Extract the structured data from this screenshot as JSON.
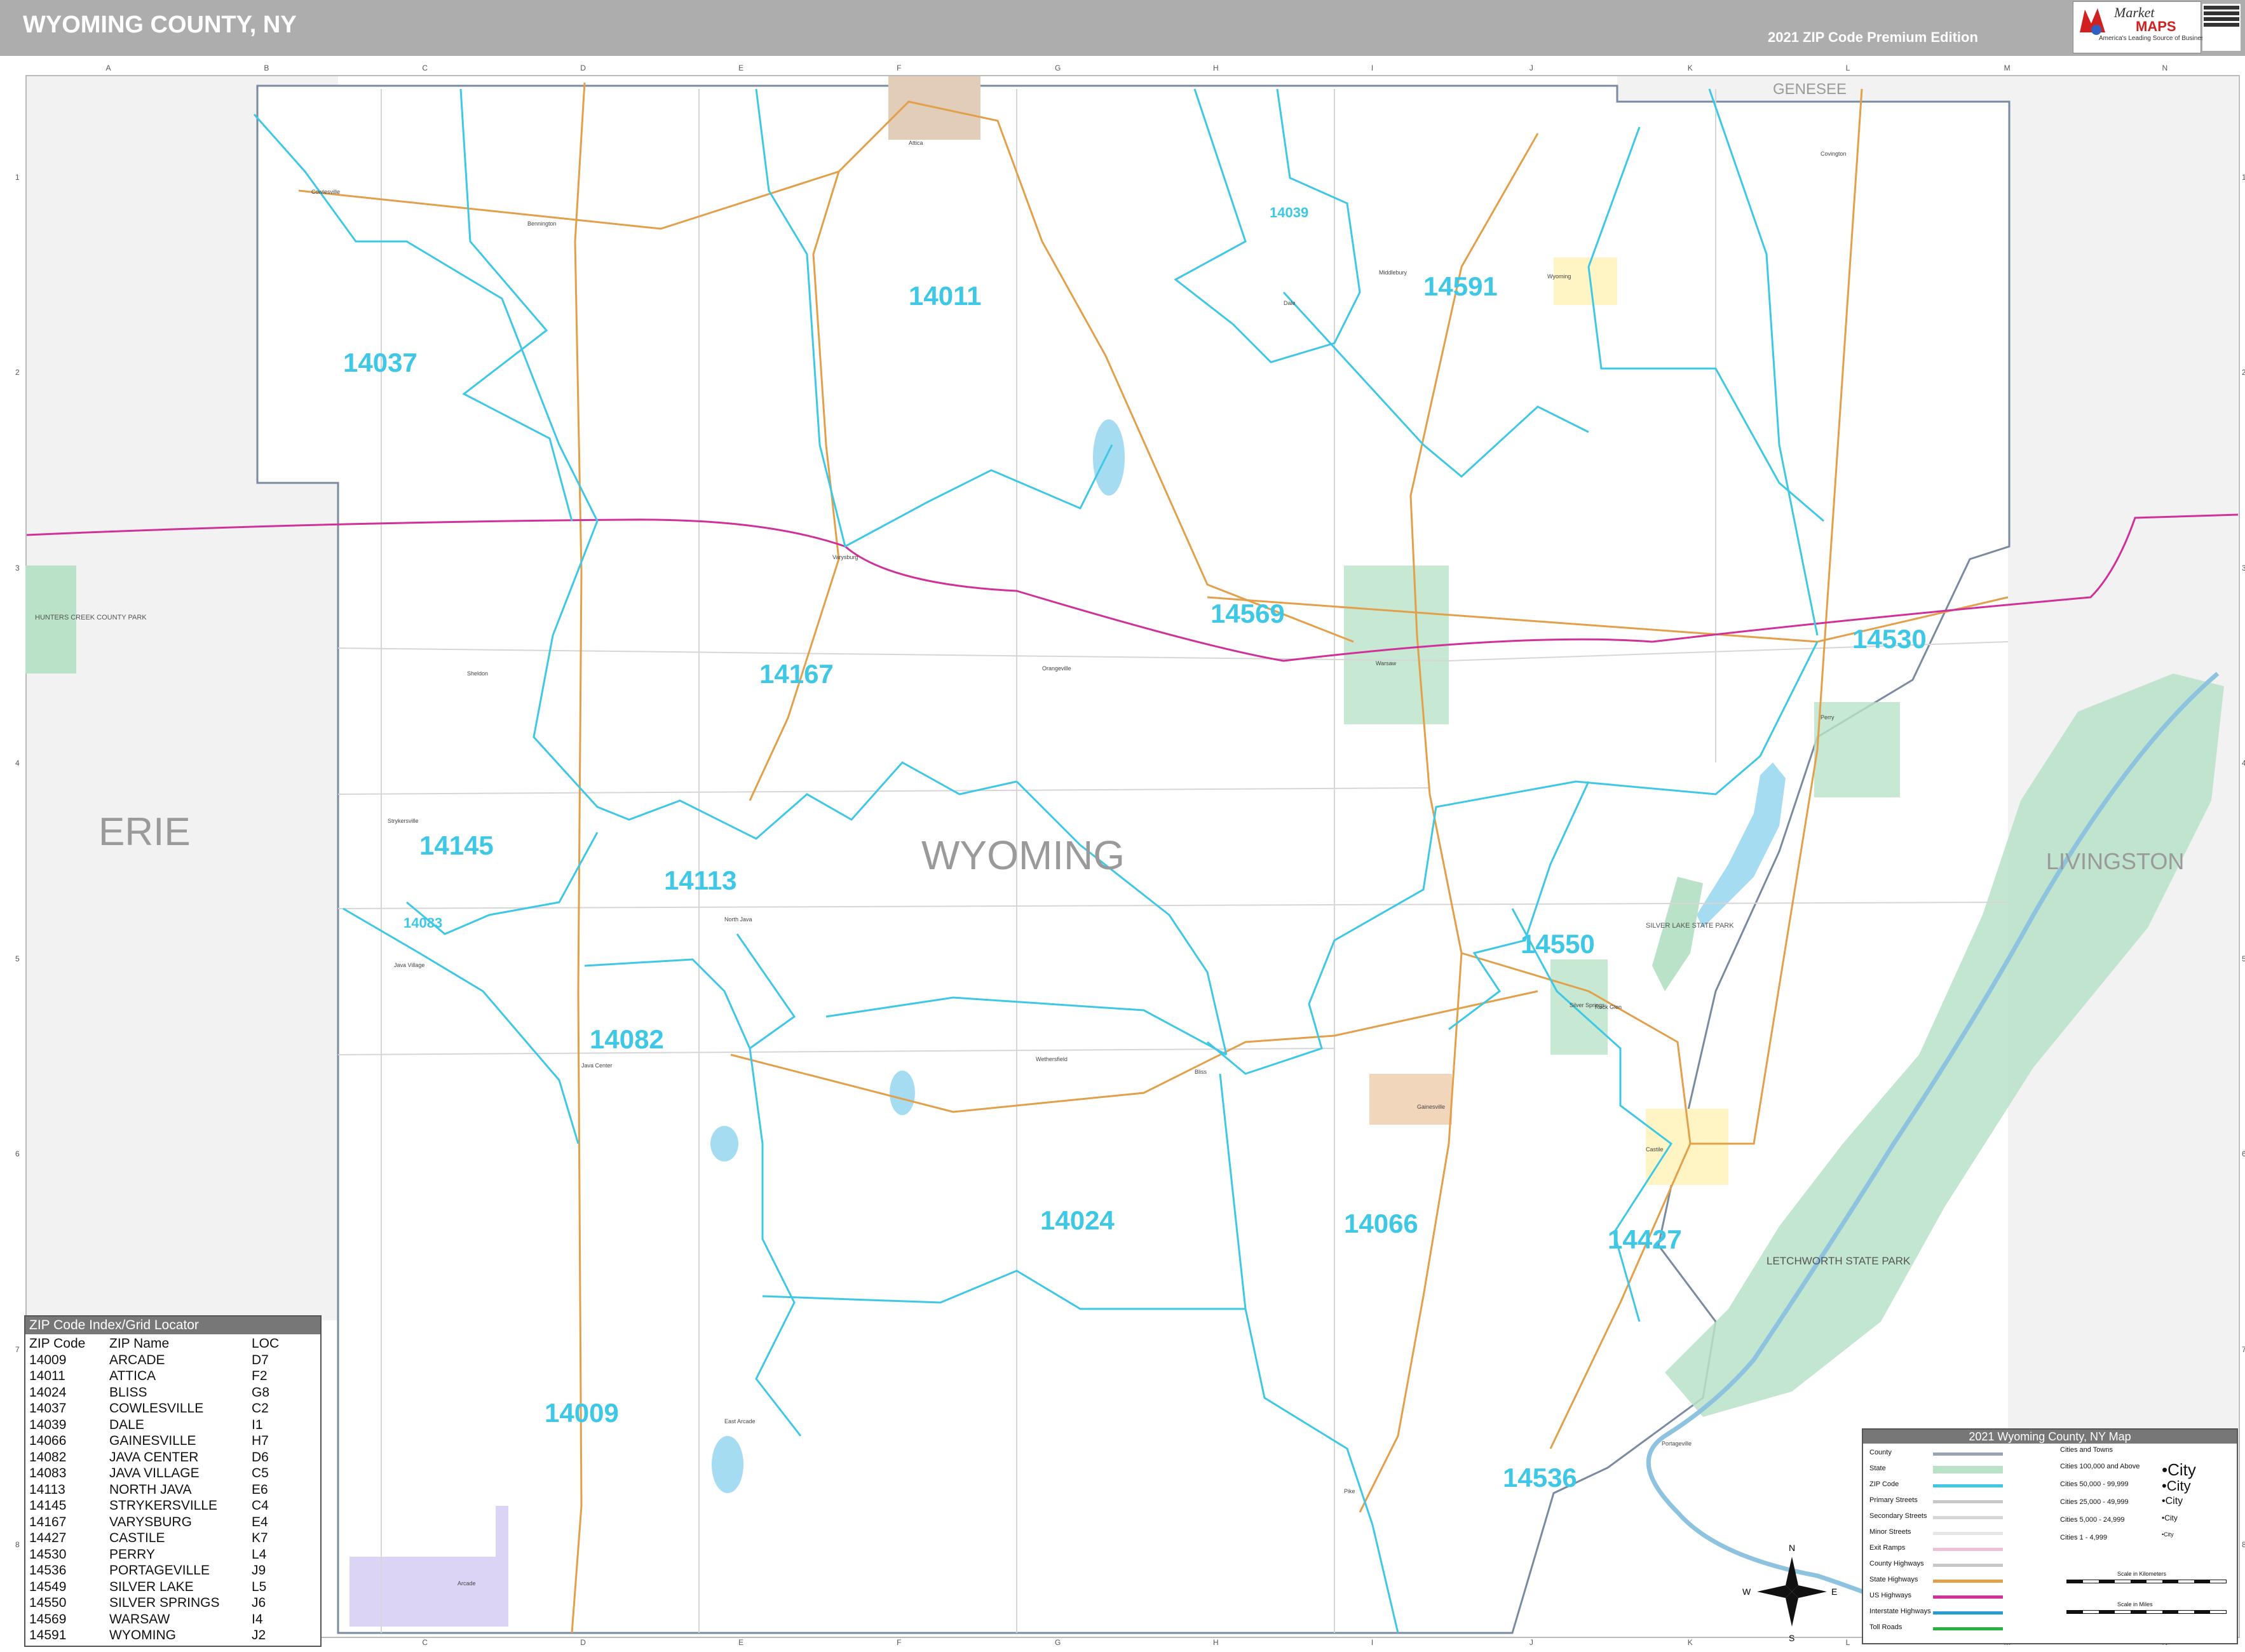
{
  "header": {
    "title": "WYOMING COUNTY, NY",
    "edition": "2021 ZIP Code Premium Edition",
    "logo_line1": "Market",
    "logo_line2": "MAPS",
    "logo_tagline": "America's Leading Source of Business Maps",
    "colors": {
      "bar": "#adadad",
      "title_text": "#ffffff"
    }
  },
  "grid": {
    "columns": [
      "A",
      "B",
      "C",
      "D",
      "E",
      "F",
      "G",
      "H",
      "I",
      "J",
      "K",
      "L",
      "M",
      "N"
    ],
    "rows": [
      "1",
      "2",
      "3",
      "4",
      "5",
      "6",
      "7",
      "8"
    ]
  },
  "counties": {
    "center": "WYOMING",
    "neighbors": [
      "ERIE",
      "LIVINGSTON",
      "GENESEE"
    ]
  },
  "parks": [
    "HUNTERS CREEK COUNTY PARK",
    "SILVER LAKE STATE PARK",
    "LETCHWORTH STATE PARK"
  ],
  "zip_labels": [
    "14037",
    "14011",
    "14039",
    "14591",
    "14569",
    "14530",
    "14167",
    "14145",
    "14113",
    "14083",
    "14550",
    "14082",
    "14024",
    "14066",
    "14427",
    "14009",
    "14536"
  ],
  "places": [
    "Attica",
    "Cowlesville",
    "Bennington",
    "Varysburg",
    "Java Center",
    "Java Village",
    "Arcade",
    "Castile",
    "Perry",
    "Warsaw",
    "Wyoming",
    "Silver Springs",
    "Gainesville",
    "Pike",
    "Strykersville",
    "Wethersfield",
    "Orangeville",
    "Portageville",
    "North Java",
    "Dale",
    "Bliss",
    "Sheldon",
    "East Arcade",
    "Covington",
    "Middlebury",
    "Rock Glen"
  ],
  "index": {
    "title": "ZIP Code Index/Grid Locator",
    "columns": [
      "ZIP Code",
      "ZIP Name",
      "LOC"
    ],
    "rows": [
      [
        "14009",
        "ARCADE",
        "D7"
      ],
      [
        "14011",
        "ATTICA",
        "F2"
      ],
      [
        "14024",
        "BLISS",
        "G8"
      ],
      [
        "14037",
        "COWLESVILLE",
        "C2"
      ],
      [
        "14039",
        "DALE",
        "I1"
      ],
      [
        "14066",
        "GAINESVILLE",
        "H7"
      ],
      [
        "14082",
        "JAVA CENTER",
        "D6"
      ],
      [
        "14083",
        "JAVA VILLAGE",
        "C5"
      ],
      [
        "14113",
        "NORTH JAVA",
        "E6"
      ],
      [
        "14145",
        "STRYKERSVILLE",
        "C4"
      ],
      [
        "14167",
        "VARYSBURG",
        "E4"
      ],
      [
        "14427",
        "CASTILE",
        "K7"
      ],
      [
        "14530",
        "PERRY",
        "L4"
      ],
      [
        "14536",
        "PORTAGEVILLE",
        "J9"
      ],
      [
        "14549",
        "SILVER LAKE",
        "L5"
      ],
      [
        "14550",
        "SILVER SPRINGS",
        "J6"
      ],
      [
        "14569",
        "WARSAW",
        "I4"
      ],
      [
        "14591",
        "WYOMING",
        "J2"
      ]
    ]
  },
  "legend": {
    "title": "2021 Wyoming County, NY Map",
    "items": [
      "County",
      "State",
      "ZIP Code",
      "Primary Streets",
      "Secondary Streets",
      "Minor Streets",
      "Exit Ramps",
      "County Highways",
      "State Highways",
      "US Highways",
      "Interstate Highways",
      "Toll Roads"
    ],
    "city_header": "Cities and Towns",
    "city_sizes": [
      "Cities 100,000 and Above",
      "Cities 50,000 - 99,999",
      "Cities 25,000 - 49,999",
      "Cities 5,000 - 24,999",
      "Cities 1 - 4,999"
    ],
    "city_word": "City",
    "compass": [
      "N",
      "S",
      "E",
      "W"
    ],
    "scale_km": "Scale in Kilometers",
    "scale_mi": "Scale in Miles"
  },
  "colors": {
    "zip_boundary": "#3ec8e6",
    "state_route": "#e2a04a",
    "interstate": "#d0309a",
    "park": "#b9e2c8",
    "water": "#a6dcf2",
    "outside_county": "#f2f2f2"
  }
}
